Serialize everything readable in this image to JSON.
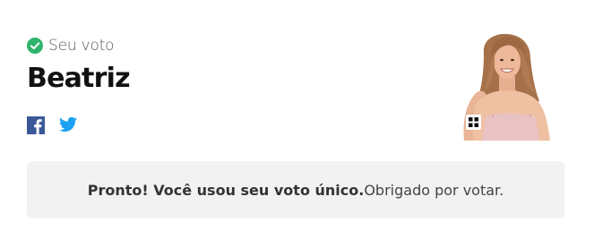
{
  "vote": {
    "status_label": "Seu voto",
    "candidate_name": "Beatriz"
  },
  "share": {
    "facebook_icon": "facebook-icon",
    "twitter_icon": "twitter-icon"
  },
  "message": {
    "strong": "Pronto! Você usou seu voto único.",
    "normal": " Obrigado por votar."
  },
  "colors": {
    "check": "#2fb36b",
    "facebook": "#3b5998",
    "twitter": "#1da1f2",
    "message_bg": "#f2f2f2"
  }
}
